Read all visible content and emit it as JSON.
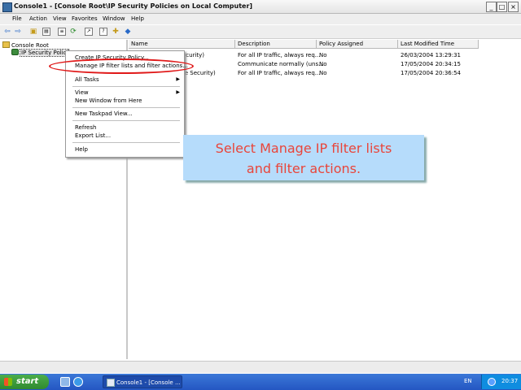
{
  "window": {
    "title": "Console1 - [Console Root\\IP Security Policies on Local Computer]",
    "controls": {
      "minimize": "_",
      "maximize": "□",
      "close": "×"
    }
  },
  "menubar": {
    "items": [
      "File",
      "Action",
      "View",
      "Favorites",
      "Window",
      "Help"
    ]
  },
  "toolbar": {
    "buttons": [
      "back-icon",
      "forward-icon",
      "up-folder-icon",
      "show-hide-tree-icon",
      "properties-icon",
      "refresh-icon",
      "export-icon",
      "help-icon",
      "add-filter-icon",
      "assign-icon"
    ]
  },
  "tree": {
    "root": "Console Root",
    "child": "IP Security Polici"
  },
  "list": {
    "columns": [
      "Name",
      "Description",
      "Policy Assigned",
      "Last Modified Time"
    ],
    "rows": [
      {
        "name": "ecurity)",
        "description": "For all IP traffic, always req...",
        "assigned": "No",
        "modified": "26/03/2004 13:29:31"
      },
      {
        "name": "",
        "description": "Communicate normally (uns...",
        "assigned": "No",
        "modified": "17/05/2004 20:34:15"
      },
      {
        "name": "re Security)",
        "description": "For all IP traffic, always req...",
        "assigned": "No",
        "modified": "17/05/2004 20:36:54"
      }
    ]
  },
  "context_menu": {
    "items": [
      "Create IP Security Policy...",
      "Manage IP filter lists and filter actions...",
      "All Tasks",
      "View",
      "New Window from Here",
      "New Taskpad View...",
      "Refresh",
      "Export List...",
      "Help"
    ],
    "submenu_arrow": "▶"
  },
  "callout": {
    "line1": "Select Manage IP filter lists",
    "line2": "and filter actions.",
    "text_color": "#e9453a",
    "background": "#b6dcfb"
  },
  "highlight": {
    "color": "#e01818"
  },
  "taskbar": {
    "start_label": "start",
    "task_item": "Console1 - [Console ...",
    "language": "EN",
    "clock": "20:37"
  }
}
